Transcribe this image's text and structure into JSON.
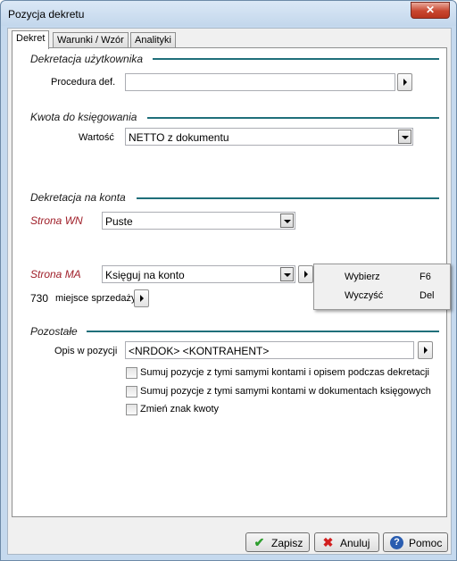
{
  "window": {
    "title": "Pozycja dekretu",
    "close_glyph": "✕"
  },
  "tabs": [
    {
      "label": "Dekret"
    },
    {
      "label": "Warunki / Wzór"
    },
    {
      "label": "Analityki"
    }
  ],
  "sections": {
    "dekretacja_uzytkownika": {
      "title": "Dekretacja użytkownika",
      "procedura_label": "Procedura def.",
      "procedura_value": ""
    },
    "kwota": {
      "title": "Kwota do księgowania",
      "wartosc_label": "Wartość",
      "wartosc_value": "NETTO z dokumentu"
    },
    "dekretacja_konta": {
      "title": "Dekretacja na konta",
      "wn_label": "Strona WN",
      "wn_value": "Puste",
      "ma_label": "Strona MA",
      "ma_value": "Księguj na konto",
      "account_number": "730",
      "account_name": "miejsce sprzedaży"
    },
    "pozostale": {
      "title": "Pozostałe",
      "opis_label": "Opis w pozycji",
      "opis_value": "<NRDOK> <KONTRAHENT>",
      "checkboxes": [
        {
          "label": "Sumuj pozycje z tymi samymi kontami i opisem podczas dekretacji",
          "checked": false
        },
        {
          "label": "Sumuj pozycje z tymi samymi kontami w dokumentach księgowych",
          "checked": false
        },
        {
          "label": "Zmień znak kwoty",
          "checked": false
        }
      ]
    }
  },
  "context_menu": {
    "items": [
      {
        "label": "Wybierz",
        "shortcut": "F6"
      },
      {
        "label": "Wyczyść",
        "shortcut": "Del"
      }
    ]
  },
  "buttons": {
    "save": {
      "label": "Zapisz",
      "icon": "check-icon",
      "glyph": "✔",
      "color": "#2e9e2e"
    },
    "cancel": {
      "label": "Anuluj",
      "icon": "x-icon",
      "glyph": "✖",
      "color": "#d21e1e"
    },
    "help": {
      "label": "Pomoc",
      "icon": "help-icon",
      "glyph": "?",
      "color": "#2a5db0"
    }
  },
  "colors": {
    "accent_line": "#1f6f7a",
    "required_label": "#a0202a"
  }
}
